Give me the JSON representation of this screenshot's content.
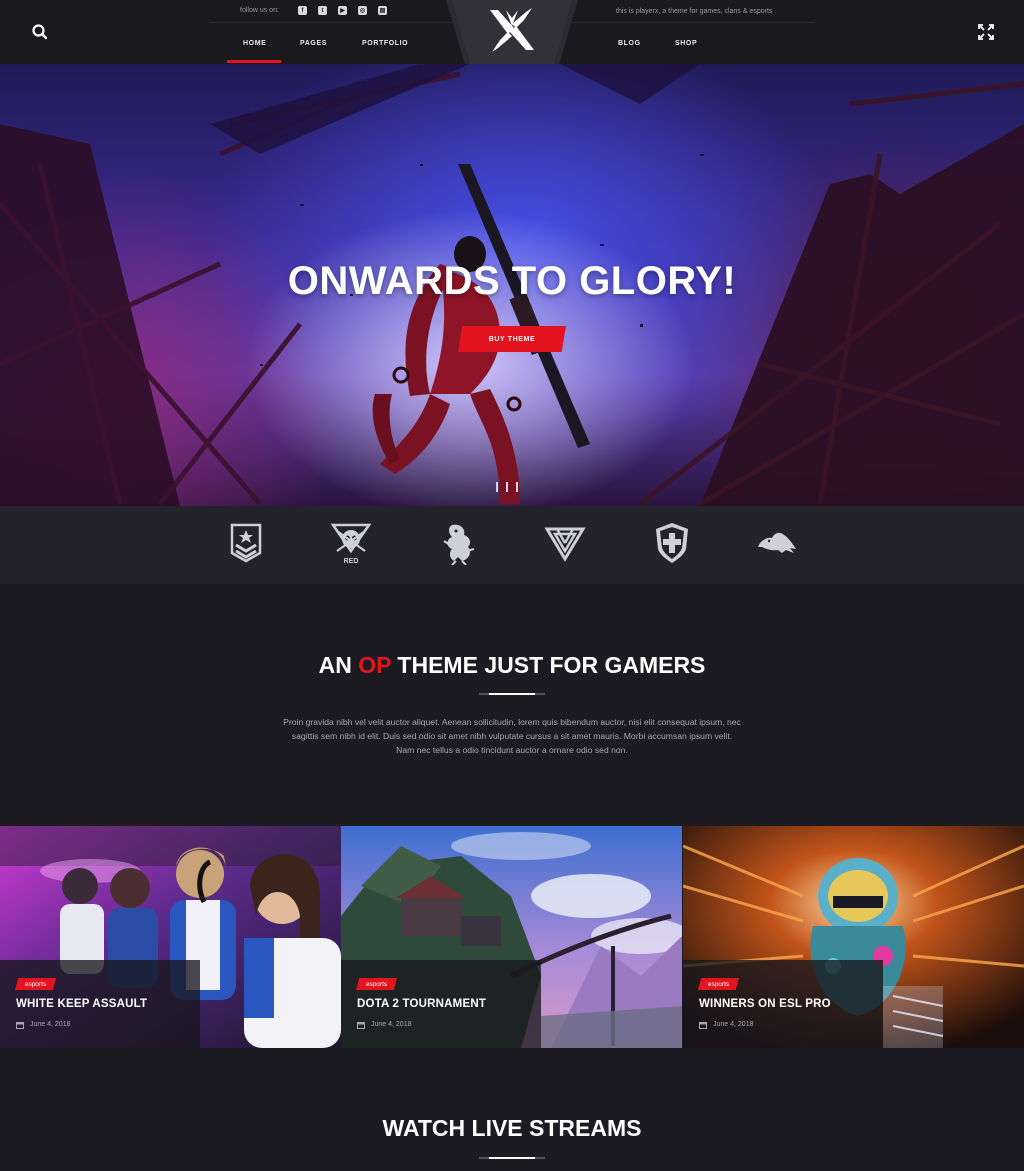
{
  "header": {
    "follow_label": "follow us on:",
    "socials": [
      {
        "icon": "facebook-icon",
        "glyph": "f"
      },
      {
        "icon": "twitter-icon",
        "glyph": "t"
      },
      {
        "icon": "youtube-icon",
        "glyph": "▶"
      },
      {
        "icon": "instagram-icon",
        "glyph": "◎"
      },
      {
        "icon": "twitch-icon",
        "glyph": "▤"
      }
    ],
    "tagline": "this is playerx, a theme for games, clans & esports",
    "nav_left": [
      "HOME",
      "PAGES",
      "PORTFOLIO"
    ],
    "nav_right": [
      "BLOG",
      "SHOP"
    ],
    "active_nav": "HOME",
    "search_icon": "search-icon",
    "expand_icon": "expand-icon",
    "logo_icon": "playerx-logo-icon"
  },
  "hero": {
    "title": "ONWARDS TO GLORY!",
    "button_label": "BUY THEME"
  },
  "badges": [
    {
      "icon": "chevron-star-badge-icon"
    },
    {
      "icon": "skull-red-badge-icon",
      "text": "RED"
    },
    {
      "icon": "lion-badge-icon"
    },
    {
      "icon": "triangle-badge-icon"
    },
    {
      "icon": "shield-cross-badge-icon"
    },
    {
      "icon": "raven-badge-icon"
    }
  ],
  "about": {
    "title_before": "AN ",
    "title_highlight": "OP",
    "title_after": " THEME JUST FOR GAMERS",
    "text": "Proin gravida nibh vel velit auctor aliquet. Aenean sollicitudin, lorem quis bibendum auctor, nisi elit consequat ipsum, nec sagittis sem nibh id elit. Duis sed odio sit amet nibh vulputate cursus a sit amet mauris. Morbi accumsan ipsum velit. Nam nec tellus a odio tincidunt auctor a ornare odio sed non."
  },
  "cards": [
    {
      "tag": "esports",
      "title": "WHITE KEEP ASSAULT",
      "date": "June 4, 2018"
    },
    {
      "tag": "esports",
      "title": "DOTA 2 TOURNAMENT",
      "date": "June 4, 2018"
    },
    {
      "tag": "esports",
      "title": "WINNERS ON ESL PRO",
      "date": "June 4, 2018"
    }
  ],
  "streams": {
    "title": "WATCH LIVE STREAMS"
  },
  "colors": {
    "accent": "#e3141f",
    "background": "#1c1b21",
    "header": "#1a191e",
    "badge_bar": "#242329"
  }
}
